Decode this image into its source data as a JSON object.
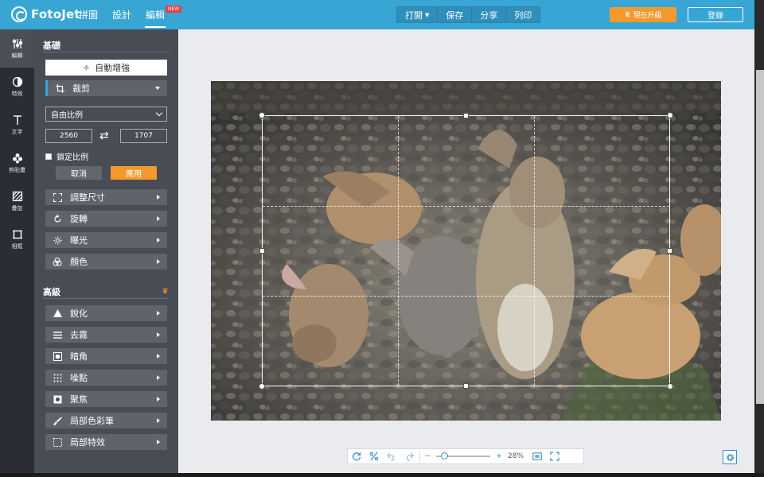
{
  "app": {
    "name": "FotoJet"
  },
  "nav": {
    "items": [
      "拼圖",
      "設計",
      "編輯"
    ],
    "active_index": 2,
    "badge": "NEW"
  },
  "top_actions": {
    "open": "打開",
    "save": "保存",
    "share": "分享",
    "print": "列印"
  },
  "upgrade_label": "現在升級",
  "login_label": "登錄",
  "rail": [
    {
      "label": "編輯",
      "icon": "sliders-icon",
      "active": true
    },
    {
      "label": "特效",
      "icon": "contrast-circle-icon",
      "active": false
    },
    {
      "label": "文字",
      "icon": "text-icon",
      "active": false
    },
    {
      "label": "剪貼畫",
      "icon": "clipart-icon",
      "active": false
    },
    {
      "label": "疊加",
      "icon": "overlay-icon",
      "active": false
    },
    {
      "label": "相框",
      "icon": "frame-icon",
      "active": false
    }
  ],
  "basic": {
    "title": "基礎",
    "auto_enhance": "自動增強",
    "crop": {
      "label": "裁剪",
      "ratio": "自由比例",
      "width": "2560",
      "height": "1707",
      "lock_label": "鎖定比例",
      "lock_checked": false,
      "cancel": "取消",
      "apply": "應用"
    },
    "tools": [
      "調整尺寸",
      "旋轉",
      "曝光",
      "顏色"
    ]
  },
  "advanced": {
    "title": "高級",
    "tools": [
      "銳化",
      "去霧",
      "暗角",
      "噪點",
      "聚焦",
      "局部色彩筆",
      "局部特效"
    ]
  },
  "zoom": {
    "value": "28%",
    "level": 0.28
  },
  "colors": {
    "topbar": "#38a6d4",
    "accent": "#f49a2c",
    "panel": "#484c54",
    "rail": "#2a2d33"
  }
}
